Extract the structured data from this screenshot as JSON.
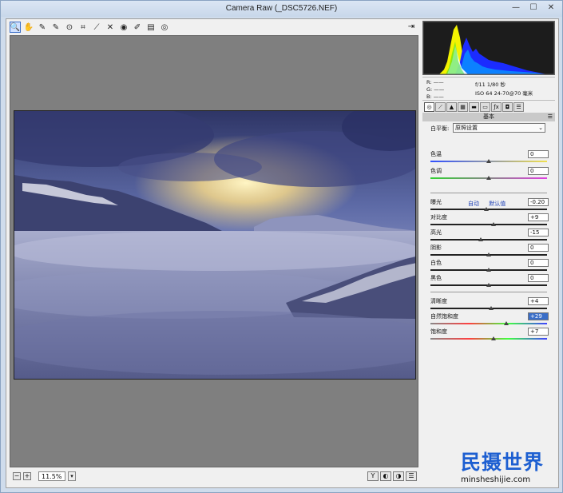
{
  "window": {
    "title": "Camera Raw (_DSC5726.NEF)"
  },
  "toolbar": {
    "tools": [
      {
        "name": "zoom-tool",
        "glyph": "🔍",
        "active": true
      },
      {
        "name": "hand-tool",
        "glyph": "✋"
      },
      {
        "name": "white-balance-tool",
        "glyph": "✎"
      },
      {
        "name": "color-sampler-tool",
        "glyph": "✎"
      },
      {
        "name": "targeted-adjustment-tool",
        "glyph": "⊙"
      },
      {
        "name": "crop-tool",
        "glyph": "⌗"
      },
      {
        "name": "straighten-tool",
        "glyph": "⟋"
      },
      {
        "name": "spot-removal-tool",
        "glyph": "✕"
      },
      {
        "name": "red-eye-tool",
        "glyph": "◉"
      },
      {
        "name": "adjustment-brush-tool",
        "glyph": "✐"
      },
      {
        "name": "graduated-filter-tool",
        "glyph": "▤"
      },
      {
        "name": "radial-filter-tool",
        "glyph": "◎"
      }
    ]
  },
  "status": {
    "zoom": "11.5%"
  },
  "info": {
    "r": "R:  ——",
    "g": "G:  ——",
    "b": "B:  ——",
    "exif_line1": "f/11   1/80 秒",
    "exif_line2": "ISO 64   24-70@70 毫米"
  },
  "panel": {
    "title": "基本",
    "white_balance_label": "白平衡:",
    "white_balance_value": "原照设置",
    "auto_label": "自动",
    "default_label": "默认值",
    "sliders": [
      {
        "key": "temp",
        "label": "色温",
        "value": "0",
        "pos": 0.5
      },
      {
        "key": "tint",
        "label": "色调",
        "value": "0",
        "pos": 0.5
      },
      {
        "key": "exposure",
        "label": "曝光",
        "value": "-0.20",
        "pos": 0.48
      },
      {
        "key": "contrast",
        "label": "对比度",
        "value": "+9",
        "pos": 0.54
      },
      {
        "key": "highlights",
        "label": "高光",
        "value": "-15",
        "pos": 0.43
      },
      {
        "key": "shadows",
        "label": "阴影",
        "value": "0",
        "pos": 0.5
      },
      {
        "key": "whites",
        "label": "白色",
        "value": "0",
        "pos": 0.5
      },
      {
        "key": "blacks",
        "label": "黑色",
        "value": "0",
        "pos": 0.5
      },
      {
        "key": "clarity",
        "label": "清晰度",
        "value": "+4",
        "pos": 0.52
      },
      {
        "key": "vibrance",
        "label": "自然饱和度",
        "value": "+29",
        "pos": 0.65,
        "selected": true
      },
      {
        "key": "saturation",
        "label": "饱和度",
        "value": "+7",
        "pos": 0.54
      }
    ]
  },
  "watermark": {
    "main": "民摄世界",
    "sub": "minsheshijie.com"
  },
  "colors": {
    "accent": "#3a6ec8",
    "watermark": "#1d5fd1"
  }
}
